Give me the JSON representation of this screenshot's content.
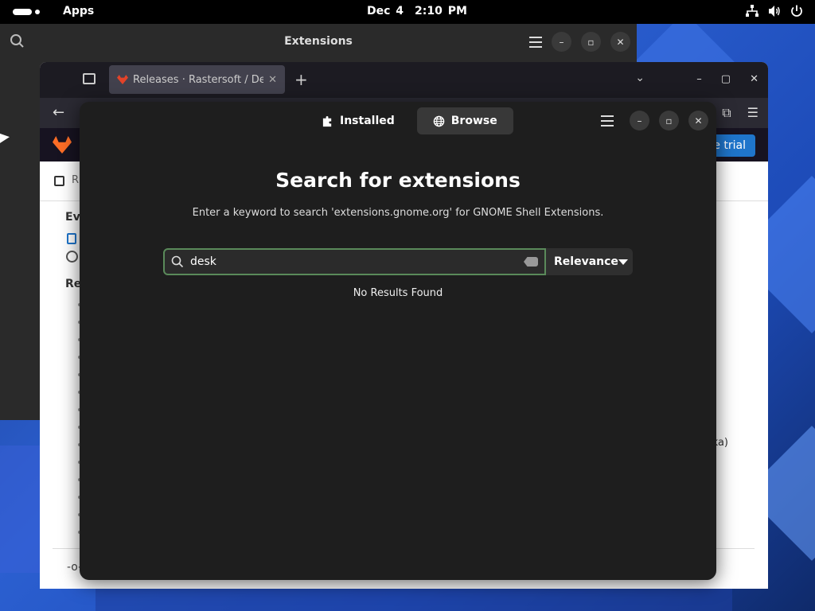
{
  "topbar": {
    "apps_label": "Apps",
    "date": "Dec 4",
    "time": "2:10 PM",
    "tray_icons": [
      "network-icon",
      "volume-icon",
      "power-icon"
    ]
  },
  "back_extensions_window": {
    "title": "Extensions"
  },
  "browser": {
    "tab_title": "Releases · Rastersoft / De",
    "trial_button_label": "e trial",
    "breadcrumb_partial": "R",
    "content": {
      "events_heading": "Ev",
      "releases_heading": "Re",
      "fragment_right": "ka)"
    }
  },
  "extensions_window": {
    "tabs": [
      {
        "label": "Installed",
        "icon": "puzzle-icon",
        "active": false
      },
      {
        "label": "Browse",
        "icon": "globe-icon",
        "active": true
      }
    ],
    "heading": "Search for extensions",
    "subtitle": "Enter a keyword to search 'extensions.gnome.org' for GNOME Shell Extensions.",
    "search": {
      "value": "desk",
      "placeholder": ""
    },
    "sort": {
      "selected": "Relevance"
    },
    "status": "No Results Found"
  },
  "colors": {
    "accent_focus": "#5a8a5a",
    "gitlab_orange": "#fc6d26",
    "trial_blue": "#1f75cb"
  }
}
